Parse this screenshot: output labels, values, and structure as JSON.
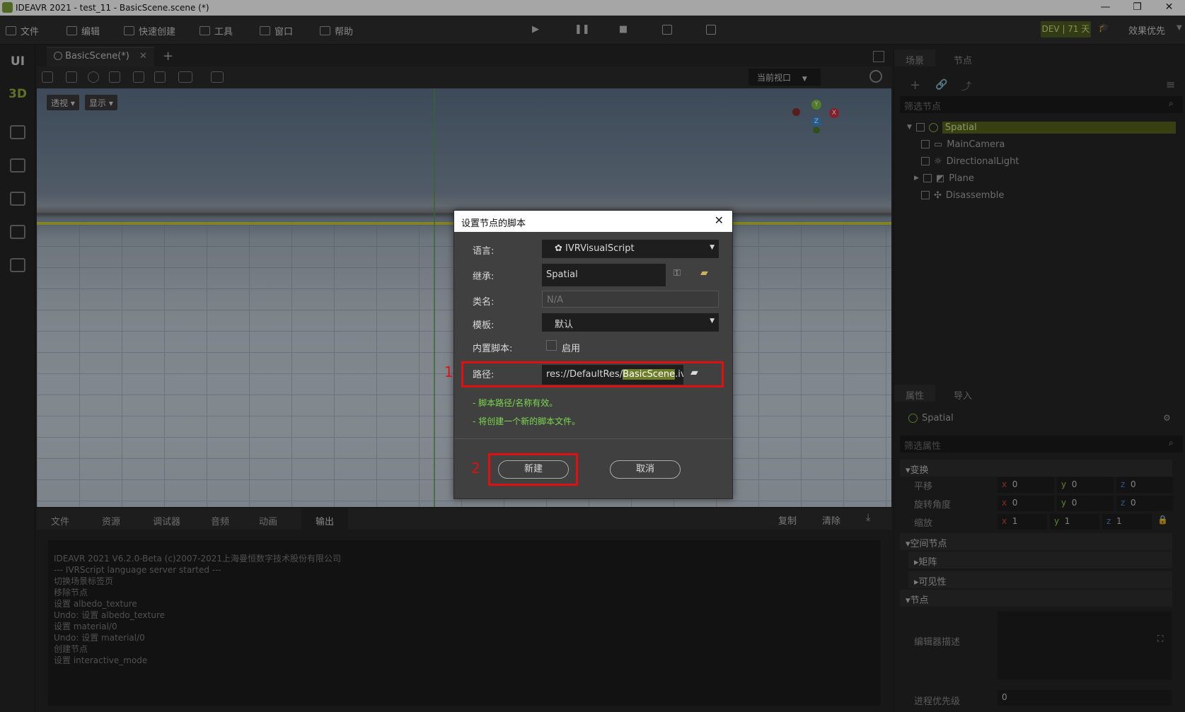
{
  "titlebar": {
    "title": "IDEAVR 2021 - test_11 - BasicScene.scene (*)",
    "min": "—",
    "max": "❐",
    "close": "✕"
  },
  "menu": {
    "items": [
      "文件",
      "编辑",
      "快速创建",
      "工具",
      "窗口",
      "帮助"
    ],
    "dev_badge": "DEV | 71 天",
    "quality": "效果优先"
  },
  "sidebar": {
    "ui": "UI",
    "d3": "3D"
  },
  "viewport": {
    "tab": "BasicScene(*)",
    "add": "+",
    "view_select": "当前视口",
    "perspective": "透视",
    "display": "显示"
  },
  "bottom": {
    "tabs": [
      "文件",
      "资源",
      "调试器",
      "音频",
      "动画",
      "输出"
    ],
    "copy": "复制",
    "clear": "清除",
    "console": [
      "IDEAVR 2021 V6.2.0-Beta (c)2007-2021上海曼恒数字技术股份有限公司",
      "--- IVRScript language server started ---",
      "切换场景标签页",
      "移除节点",
      "设置 albedo_texture",
      "Undo: 设置 albedo_texture",
      "设置 material/0",
      "Undo: 设置 material/0",
      "创建节点",
      "设置 interactive_mode"
    ]
  },
  "scene_panel": {
    "tabs": [
      "场景",
      "节点"
    ],
    "filter": "筛选节点",
    "nodes": [
      "Spatial",
      "MainCamera",
      "DirectionalLight",
      "Plane",
      "Disassemble"
    ]
  },
  "props_panel": {
    "tabs": [
      "属性",
      "导入"
    ],
    "node": "Spatial",
    "filter": "筛选属性",
    "transform": "变换",
    "translate": "平移",
    "rotate": "旋转角度",
    "scale": "缩放",
    "t": [
      "0",
      "0",
      "0"
    ],
    "r": [
      "0",
      "0",
      "0"
    ],
    "s": [
      "1",
      "1",
      "1"
    ],
    "spatial": "空间节点",
    "matrix": "矩阵",
    "visibility": "可见性",
    "node_sect": "节点",
    "editor_desc": "编辑器描述",
    "priority": "进程优先级",
    "priority_val": "0",
    "axes": [
      "x",
      "y",
      "z"
    ]
  },
  "dialog": {
    "title": "设置节点的脚本",
    "lang_label": "语言:",
    "lang": "IVRVisualScript",
    "inherit_label": "继承:",
    "inherit": "Spatial",
    "class_label": "类名:",
    "class": "N/A",
    "template_label": "模板:",
    "template": "默认",
    "builtin_label": "内置脚本:",
    "builtin_opt": "启用",
    "path_label": "路径:",
    "path_a": "res://DefaultRes/",
    "path_b": "BasicScene",
    "path_c": ".ivs",
    "note1": "- 脚本路径/名称有效。",
    "note2": "- 将创建一个新的脚本文件。",
    "create": "新建",
    "cancel": "取消",
    "mark1": "1",
    "mark2": "2"
  }
}
